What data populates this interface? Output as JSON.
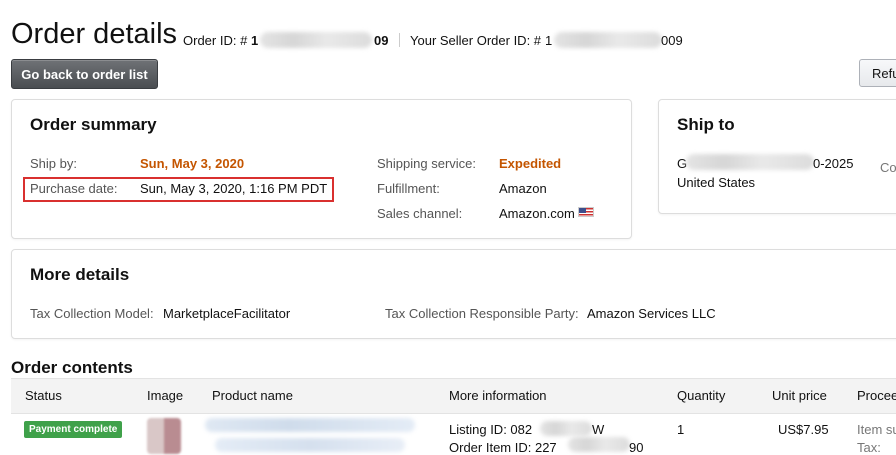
{
  "header": {
    "title": "Order details",
    "order_id_label": "Order ID: #",
    "order_id_start": "1",
    "order_id_end": "09",
    "seller_order_id_label": "Your Seller Order ID: #",
    "seller_order_id_start": "1",
    "seller_order_id_end": "009"
  },
  "actions": {
    "back_label": "Go back to order list",
    "refund_label": "Refu"
  },
  "order_summary": {
    "title": "Order summary",
    "ship_by_label": "Ship by:",
    "ship_by_value": "Sun, May 3, 2020",
    "purchase_date_label": "Purchase date:",
    "purchase_date_value": "Sun, May 3, 2020, 1:16 PM PDT",
    "shipping_service_label": "Shipping service:",
    "shipping_service_value": "Expedited",
    "fulfillment_label": "Fulfillment:",
    "fulfillment_value": "Amazon",
    "sales_channel_label": "Sales channel:",
    "sales_channel_value": "Amazon.com"
  },
  "ship_to": {
    "title": "Ship to",
    "address_start": "G",
    "address_end": "0-2025",
    "country": "United States",
    "contact_partial": "Co"
  },
  "more_details": {
    "title": "More details",
    "tax_model_label": "Tax Collection Model:",
    "tax_model_value": "MarketplaceFacilitator",
    "tax_party_label": "Tax Collection Responsible Party:",
    "tax_party_value": "Amazon Services LLC"
  },
  "order_contents": {
    "title": "Order contents",
    "columns": [
      "Status",
      "Image",
      "Product name",
      "More information",
      "Quantity",
      "Unit price",
      "Procee"
    ],
    "row": {
      "status": "Payment complete",
      "listing_id_label": "Listing ID: 082",
      "listing_id_end": "W",
      "order_item_id_label": "Order Item ID: 227",
      "order_item_id_end": "90",
      "quantity": "1",
      "unit_price": "US$7.95",
      "proceeds_line1": "Item su",
      "proceeds_line2": "Tax:"
    }
  },
  "colors": {
    "accent_orange": "#c45500",
    "highlight_red": "#d9302f",
    "status_green": "#3fa14a",
    "button_dark": "#4a4d51"
  }
}
